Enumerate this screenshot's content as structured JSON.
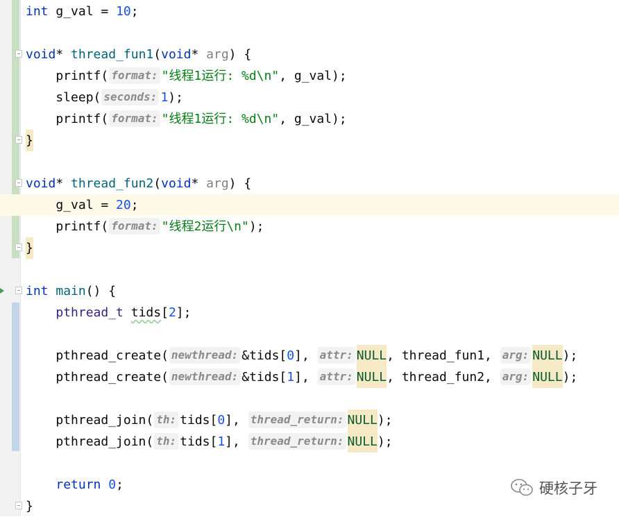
{
  "colors": {
    "keyword": "#0033b3",
    "function": "#00627a",
    "number": "#1750eb",
    "string": "#067d17",
    "hint_bg": "#f2f2f2",
    "null_highlight": "#f5eac5",
    "current_line": "#fdfbe8",
    "vcs_added": "#c9dfc1",
    "vcs_modified": "#c3d6e8"
  },
  "editor": {
    "current_line_index": 9,
    "lines": [
      {
        "tokens": [
          {
            "t": "int",
            "c": "kw"
          },
          {
            "t": " g_val = "
          },
          {
            "t": "10",
            "c": "num"
          },
          {
            "t": ";"
          }
        ]
      },
      {
        "tokens": []
      },
      {
        "fold": true,
        "tokens": [
          {
            "t": "void",
            "c": "kw"
          },
          {
            "t": "* "
          },
          {
            "t": "thread_fun1",
            "c": "fn"
          },
          {
            "t": "("
          },
          {
            "t": "void",
            "c": "kw"
          },
          {
            "t": "* "
          },
          {
            "t": "arg",
            "c": "param"
          },
          {
            "t": ") {"
          }
        ]
      },
      {
        "tokens": [
          {
            "t": "    printf("
          },
          {
            "t": "format:",
            "c": "hint"
          },
          {
            "t": "\"线程1运行: %d\\n\"",
            "c": "str"
          },
          {
            "t": ", g_val);"
          }
        ]
      },
      {
        "tokens": [
          {
            "t": "    sleep("
          },
          {
            "t": "seconds:",
            "c": "hint"
          },
          {
            "t": "1",
            "c": "num"
          },
          {
            "t": ");"
          }
        ]
      },
      {
        "tokens": [
          {
            "t": "    printf("
          },
          {
            "t": "format:",
            "c": "hint"
          },
          {
            "t": "\"线程1运行: %d\\n\"",
            "c": "str"
          },
          {
            "t": ", g_val);"
          }
        ]
      },
      {
        "fold": true,
        "tokens": [
          {
            "t": "}",
            "c": "brace"
          }
        ]
      },
      {
        "tokens": []
      },
      {
        "fold": true,
        "tokens": [
          {
            "t": "void",
            "c": "kw"
          },
          {
            "t": "* "
          },
          {
            "t": "thread_fun2",
            "c": "fn"
          },
          {
            "t": "("
          },
          {
            "t": "void",
            "c": "kw"
          },
          {
            "t": "* "
          },
          {
            "t": "arg",
            "c": "param"
          },
          {
            "t": ") {"
          }
        ]
      },
      {
        "tokens": [
          {
            "t": "    g_val = "
          },
          {
            "t": "20",
            "c": "num"
          },
          {
            "t": ";"
          }
        ]
      },
      {
        "tokens": [
          {
            "t": "    printf("
          },
          {
            "t": "format:",
            "c": "hint"
          },
          {
            "t": "\"线程2运行\\n\"",
            "c": "str"
          },
          {
            "t": ");"
          }
        ]
      },
      {
        "fold": true,
        "tokens": [
          {
            "t": "}",
            "c": "brace"
          }
        ]
      },
      {
        "tokens": []
      },
      {
        "fold": true,
        "run": true,
        "tokens": [
          {
            "t": "int",
            "c": "kw"
          },
          {
            "t": " "
          },
          {
            "t": "main",
            "c": "fn"
          },
          {
            "t": "() {"
          }
        ]
      },
      {
        "tokens": [
          {
            "t": "    "
          },
          {
            "t": "pthread_t",
            "c": "type"
          },
          {
            "t": " "
          },
          {
            "t": "tids",
            "c": "warn"
          },
          {
            "t": "["
          },
          {
            "t": "2",
            "c": "num"
          },
          {
            "t": "];"
          }
        ]
      },
      {
        "tokens": []
      },
      {
        "tokens": [
          {
            "t": "    pthread_create("
          },
          {
            "t": "newthread:",
            "c": "hint"
          },
          {
            "t": "&tids["
          },
          {
            "t": "0",
            "c": "num"
          },
          {
            "t": "], "
          },
          {
            "t": "attr:",
            "c": "hint"
          },
          {
            "t": "NULL",
            "c": "macro"
          },
          {
            "t": ", thread_fun1, "
          },
          {
            "t": "arg:",
            "c": "hint"
          },
          {
            "t": "NULL",
            "c": "macro"
          },
          {
            "t": ");"
          }
        ]
      },
      {
        "tokens": [
          {
            "t": "    pthread_create("
          },
          {
            "t": "newthread:",
            "c": "hint"
          },
          {
            "t": "&tids["
          },
          {
            "t": "1",
            "c": "num"
          },
          {
            "t": "], "
          },
          {
            "t": "attr:",
            "c": "hint"
          },
          {
            "t": "NULL",
            "c": "macro"
          },
          {
            "t": ", thread_fun2, "
          },
          {
            "t": "arg:",
            "c": "hint"
          },
          {
            "t": "NULL",
            "c": "macro"
          },
          {
            "t": ");"
          }
        ]
      },
      {
        "tokens": []
      },
      {
        "tokens": [
          {
            "t": "    pthread_join("
          },
          {
            "t": "th:",
            "c": "hint"
          },
          {
            "t": "tids["
          },
          {
            "t": "0",
            "c": "num"
          },
          {
            "t": "], "
          },
          {
            "t": "thread_return:",
            "c": "hint"
          },
          {
            "t": "NULL",
            "c": "macro"
          },
          {
            "t": ");"
          }
        ]
      },
      {
        "tokens": [
          {
            "t": "    pthread_join("
          },
          {
            "t": "th:",
            "c": "hint"
          },
          {
            "t": "tids["
          },
          {
            "t": "1",
            "c": "num"
          },
          {
            "t": "], "
          },
          {
            "t": "thread_return:",
            "c": "hint"
          },
          {
            "t": "NULL",
            "c": "macro"
          },
          {
            "t": ");"
          }
        ]
      },
      {
        "tokens": []
      },
      {
        "tokens": [
          {
            "t": "    "
          },
          {
            "t": "return",
            "c": "kw"
          },
          {
            "t": " "
          },
          {
            "t": "0",
            "c": "num"
          },
          {
            "t": ";"
          }
        ]
      },
      {
        "fold": true,
        "tokens": [
          {
            "t": "}"
          }
        ]
      }
    ]
  },
  "watermark": {
    "icon": "wechat-icon",
    "text": "硬核子牙"
  }
}
